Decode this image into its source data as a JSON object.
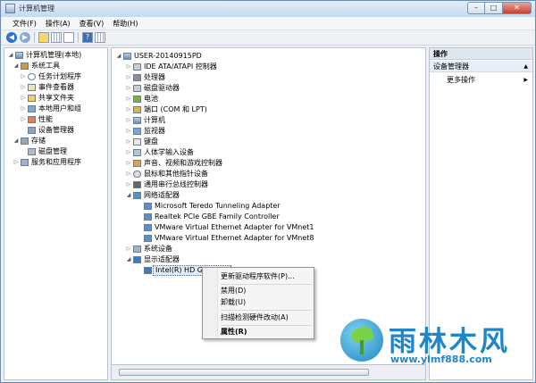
{
  "window": {
    "title": "计算机管理",
    "buttons": {
      "minimize": "–",
      "maximize": "□",
      "close": "✕"
    }
  },
  "menubar": [
    "文件(F)",
    "操作(A)",
    "查看(V)",
    "帮助(H)"
  ],
  "left_tree": [
    {
      "label": "计算机管理(本地)",
      "icon": "computer-icon",
      "twisty": "◢"
    },
    {
      "label": "系统工具",
      "icon": "tools-icon",
      "twisty": "◢"
    },
    {
      "label": "任务计划程序",
      "icon": "clock-icon",
      "twisty": "▷"
    },
    {
      "label": "事件查看器",
      "icon": "log-icon",
      "twisty": "▷"
    },
    {
      "label": "共享文件夹",
      "icon": "folder-icon",
      "twisty": "▷"
    },
    {
      "label": "本地用户和组",
      "icon": "users-icon",
      "twisty": "▷"
    },
    {
      "label": "性能",
      "icon": "performance-icon",
      "twisty": "▷"
    },
    {
      "label": "设备管理器",
      "icon": "device-manager-icon",
      "twisty": ""
    },
    {
      "label": "存储",
      "icon": "storage-icon",
      "twisty": "◢"
    },
    {
      "label": "磁盘管理",
      "icon": "disk-management-icon",
      "twisty": ""
    },
    {
      "label": "服务和应用程序",
      "icon": "services-icon",
      "twisty": "▷"
    }
  ],
  "device_tree": [
    {
      "label": "USER-20140915PD",
      "icon": "computer-icon",
      "twisty": "◢"
    },
    {
      "label": "IDE ATA/ATAPI 控制器",
      "icon": "disk-icon",
      "twisty": "▷"
    },
    {
      "label": "处理器",
      "icon": "cpu-icon",
      "twisty": "▷"
    },
    {
      "label": "磁盘驱动器",
      "icon": "disk-icon",
      "twisty": "▷"
    },
    {
      "label": "电池",
      "icon": "battery-icon",
      "twisty": "▷"
    },
    {
      "label": "端口 (COM 和 LPT)",
      "icon": "port-icon",
      "twisty": "▷"
    },
    {
      "label": "计算机",
      "icon": "computer-icon",
      "twisty": "▷"
    },
    {
      "label": "监视器",
      "icon": "monitor-icon",
      "twisty": "▷"
    },
    {
      "label": "键盘",
      "icon": "keyboard-icon",
      "twisty": "▷"
    },
    {
      "label": "人体学输入设备",
      "icon": "hid-icon",
      "twisty": "▷"
    },
    {
      "label": "声音、视频和游戏控制器",
      "icon": "sound-icon",
      "twisty": "▷"
    },
    {
      "label": "鼠标和其他指针设备",
      "icon": "mouse-icon",
      "twisty": "▷"
    },
    {
      "label": "通用串行总线控制器",
      "icon": "usb-icon",
      "twisty": "▷"
    },
    {
      "label": "网络适配器",
      "icon": "network-icon",
      "twisty": "◢"
    },
    {
      "label": "Microsoft Teredo Tunneling Adapter",
      "icon": "network-adapter-icon",
      "twisty": ""
    },
    {
      "label": "Realtek PCIe GBE Family Controller",
      "icon": "network-adapter-icon",
      "twisty": ""
    },
    {
      "label": "VMware Virtual Ethernet Adapter for VMnet1",
      "icon": "network-adapter-icon",
      "twisty": ""
    },
    {
      "label": "VMware Virtual Ethernet Adapter for VMnet8",
      "icon": "network-adapter-icon",
      "twisty": ""
    },
    {
      "label": "系统设备",
      "icon": "system-icon",
      "twisty": "▷"
    },
    {
      "label": "显示适配器",
      "icon": "display-icon",
      "twisty": "◢"
    },
    {
      "label": "Intel(R) HD Graphics",
      "icon": "display-adapter-icon",
      "twisty": ""
    }
  ],
  "actions": {
    "header": "操作",
    "section": "设备管理器",
    "more": "更多操作",
    "chev_section": "▲",
    "chev_more": "▶"
  },
  "context_menu": [
    "更新驱动程序软件(P)...",
    "禁用(D)",
    "卸载(U)",
    "扫描检测硬件改动(A)",
    "属性(R)"
  ],
  "watermark": {
    "name": "雨林木风",
    "url": "www.ylmf888.com"
  }
}
